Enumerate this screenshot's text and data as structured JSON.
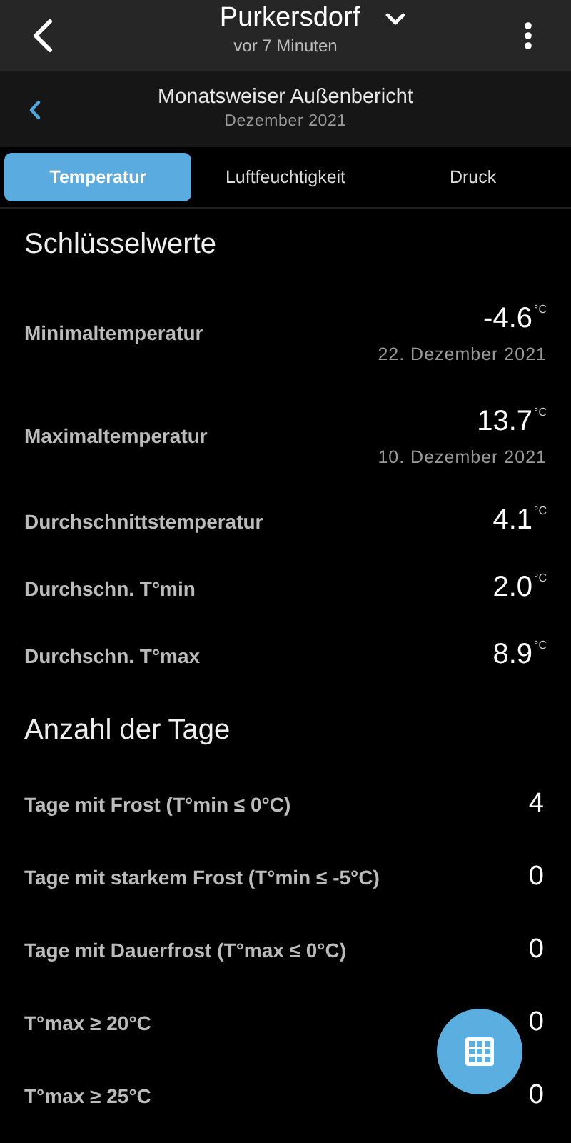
{
  "header": {
    "title": "Purkersdorf",
    "subtitle": "vor 7 Minuten"
  },
  "report": {
    "title": "Monatsweiser Außenbericht",
    "subtitle": "Dezember 2021"
  },
  "tabs": [
    {
      "label": "Temperatur",
      "selected": true
    },
    {
      "label": "Luftfeuchtigkeit",
      "selected": false
    },
    {
      "label": "Druck",
      "selected": false
    }
  ],
  "sections": [
    {
      "title": "Schlüsselwerte",
      "rows": [
        {
          "label": "Minimaltemperatur",
          "value": "-4.6",
          "unit": "°C",
          "date": "22. Dezember 2021"
        },
        {
          "label": "Maximaltemperatur",
          "value": "13.7",
          "unit": "°C",
          "date": "10. Dezember 2021"
        },
        {
          "label": "Durchschnittstemperatur",
          "value": "4.1",
          "unit": "°C"
        },
        {
          "label": "Durchschn. T°min",
          "value": "2.0",
          "unit": "°C"
        },
        {
          "label": "Durchschn. T°max",
          "value": "8.9",
          "unit": "°C"
        }
      ]
    },
    {
      "title": "Anzahl der Tage",
      "rows": [
        {
          "label": "Tage mit Frost (T°min ≤ 0°C)",
          "value": "4"
        },
        {
          "label": "Tage mit starkem Frost (T°min ≤ -5°C)",
          "value": "0"
        },
        {
          "label": "Tage mit Dauerfrost (T°max ≤ 0°C)",
          "value": "0"
        },
        {
          "label": "T°max ≥ 20°C",
          "value": "0"
        },
        {
          "label": "T°max ≥ 25°C",
          "value": "0"
        }
      ]
    }
  ]
}
